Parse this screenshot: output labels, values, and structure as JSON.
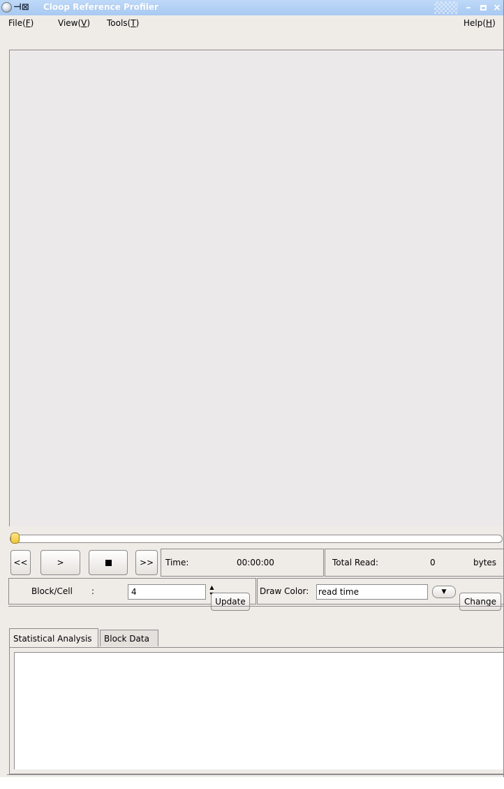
{
  "window": {
    "title": "Cloop Reference Profiler",
    "controls": {
      "minimize": "–",
      "close": "×"
    }
  },
  "menubar": {
    "file": {
      "label": "File(",
      "key": "F",
      "end": ")"
    },
    "view": {
      "label": "View(",
      "key": "V",
      "end": ")"
    },
    "tools": {
      "label": "Tools(",
      "key": "T",
      "end": ")"
    },
    "help": {
      "label": "Help(",
      "key": "H",
      "end": ")"
    }
  },
  "slider": {
    "position": 0
  },
  "transport": {
    "prev": "<<",
    "play": ">",
    "next": ">>"
  },
  "time": {
    "label": "Time:",
    "value": "00:00:00"
  },
  "total_read": {
    "label": "Total Read:",
    "value": "0",
    "unit": "bytes"
  },
  "block_cell": {
    "label": "Block/Cell",
    "colon": ":",
    "value": "4",
    "update_button": "Update"
  },
  "draw_color": {
    "label": "Draw Color:",
    "value": "read time",
    "change_button": "Change"
  },
  "tabs": [
    {
      "label": "Statistical Analysis",
      "active": true
    },
    {
      "label": "Block Data",
      "active": false
    }
  ],
  "colors": {
    "titlebar": "#a9c9f2",
    "window_bg": "#efebe7",
    "slider_handle": "#f0c53a"
  }
}
